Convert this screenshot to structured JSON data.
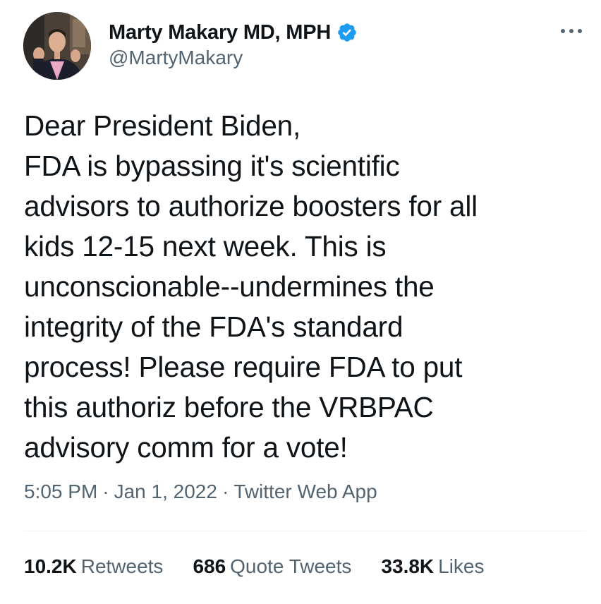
{
  "user": {
    "display_name": "Marty Makary MD, MPH",
    "handle": "@MartyMakary",
    "verified_icon": "verified-badge-icon",
    "verified_color": "#1d9bf0"
  },
  "tweet": {
    "text": "Dear President Biden,\nFDA is bypassing it's scientific\nadvisors to authorize boosters for all\nkids 12-15 next week. This is\nunconscionable--undermines the\nintegrity of the FDA's standard\nprocess! Please require FDA to put\nthis authoriz before the VRBPAC\nadvisory comm for a vote!",
    "time": "5:05 PM",
    "date": "Jan 1, 2022",
    "source": "Twitter Web App",
    "separator": "·"
  },
  "stats": {
    "retweets_count": "10.2K",
    "retweets_label": "Retweets",
    "quotes_count": "686",
    "quotes_label": "Quote Tweets",
    "likes_count": "33.8K",
    "likes_label": "Likes"
  },
  "colors": {
    "text_primary": "#0f1419",
    "text_secondary": "#536471",
    "divider": "#eff3f4"
  }
}
